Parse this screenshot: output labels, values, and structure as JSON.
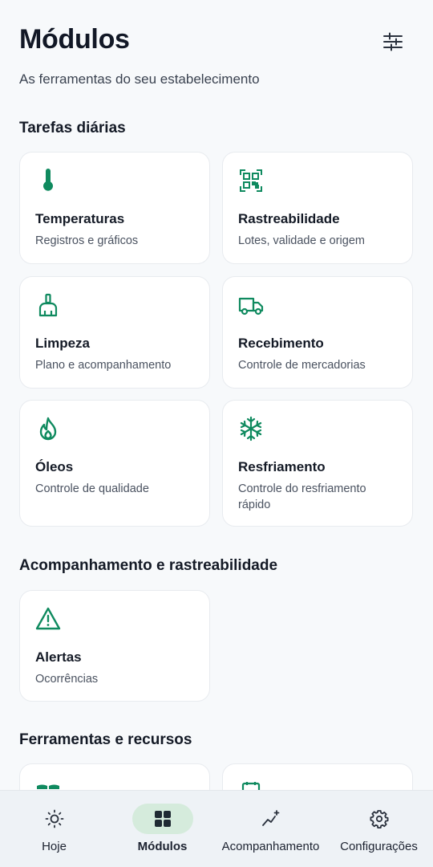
{
  "header": {
    "title": "Módulos",
    "subtitle": "As ferramentas do seu estabelecimento"
  },
  "accent_color": "#0f8a5f",
  "sections": [
    {
      "title": "Tarefas diárias",
      "cards": [
        {
          "title": "Temperaturas",
          "description": "Registros e gráficos",
          "icon": "thermometer-icon"
        },
        {
          "title": "Rastreabilidade",
          "description": "Lotes, validade e origem",
          "icon": "qr-code-icon"
        },
        {
          "title": "Limpeza",
          "description": "Plano e acompanhamento",
          "icon": "broom-icon"
        },
        {
          "title": "Recebimento",
          "description": "Controle de mercadorias",
          "icon": "truck-icon"
        },
        {
          "title": "Óleos",
          "description": "Controle de qualidade",
          "icon": "flame-icon"
        },
        {
          "title": "Resfriamento",
          "description": "Controle do resfriamento rápido",
          "icon": "snowflake-icon"
        }
      ]
    },
    {
      "title": "Acompanhamento e rastreabilidade",
      "cards": [
        {
          "title": "Alertas",
          "description": "Ocorrências",
          "icon": "warning-icon"
        }
      ]
    },
    {
      "title": "Ferramentas e recursos",
      "cards": []
    }
  ],
  "nav": {
    "items": [
      {
        "label": "Hoje",
        "icon": "sun-icon",
        "active": false
      },
      {
        "label": "Módulos",
        "icon": "grid-icon",
        "active": true
      },
      {
        "label": "Acompanhamento",
        "icon": "chart-sparkle-icon",
        "active": false
      },
      {
        "label": "Configurações",
        "icon": "gear-icon",
        "active": false
      }
    ]
  }
}
